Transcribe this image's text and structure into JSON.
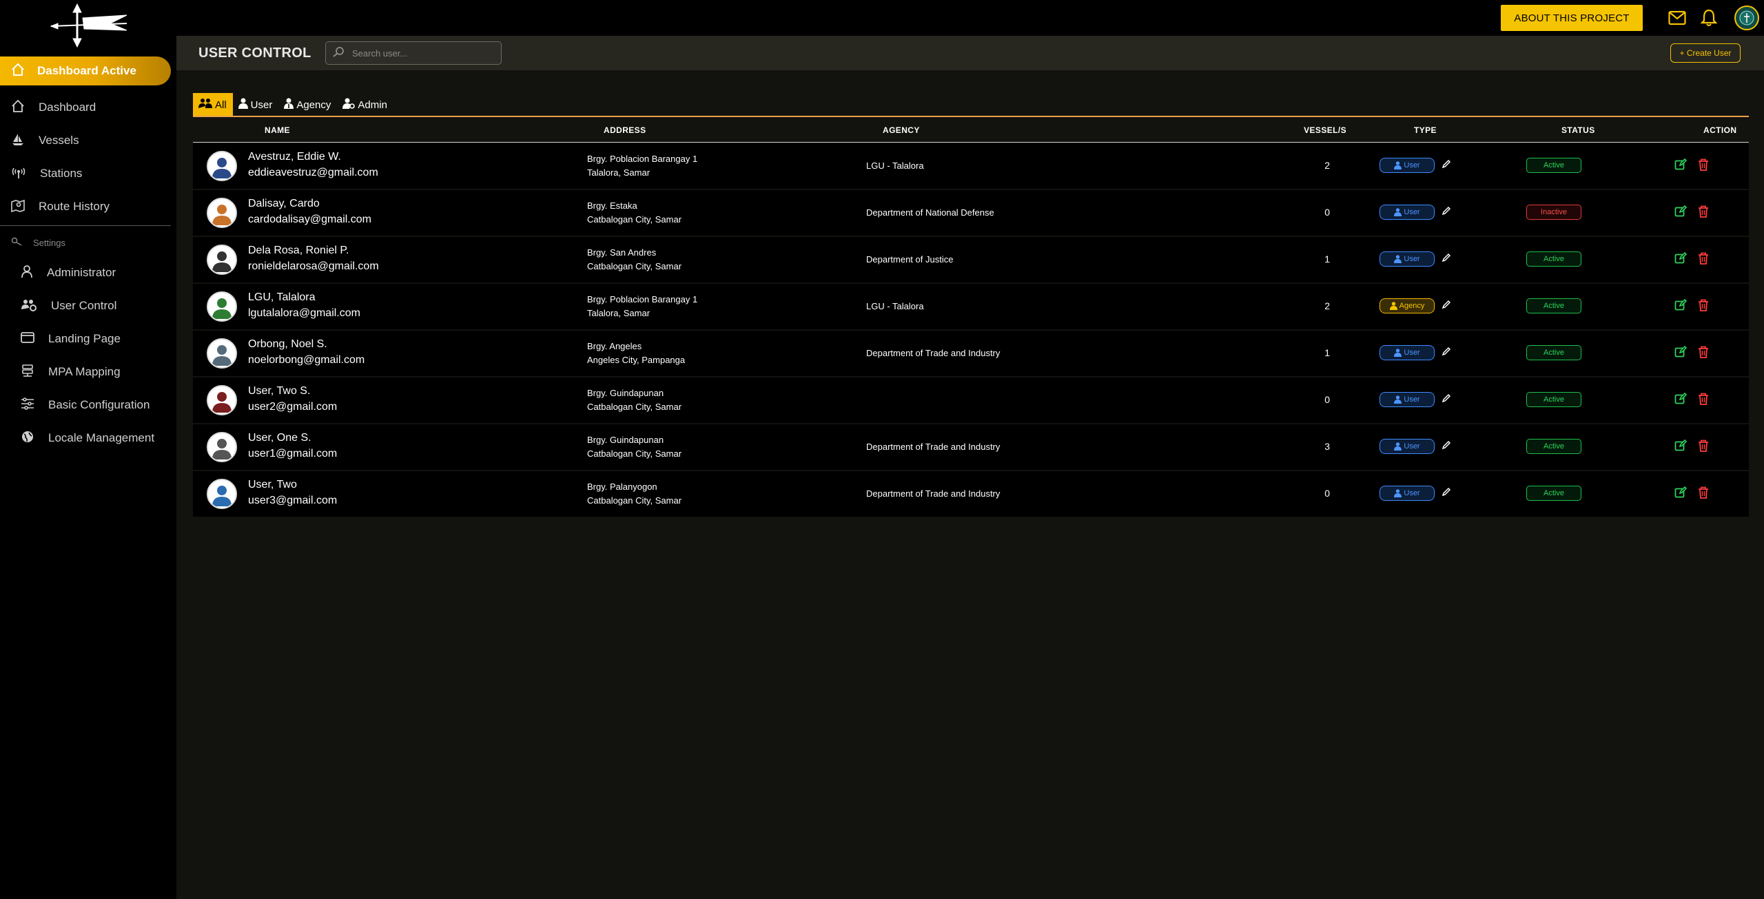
{
  "app": {
    "about_label": "ABOUT THIS PROJECT"
  },
  "sidebar": {
    "active_label": "Dashboard Active",
    "items": [
      {
        "label": "Dashboard",
        "icon": "house-icon"
      },
      {
        "label": "Vessels",
        "icon": "sailboat-icon"
      },
      {
        "label": "Stations",
        "icon": "antenna-icon"
      },
      {
        "label": "Route History",
        "icon": "map-pin-icon"
      }
    ],
    "settings_label": "Settings",
    "settings_items": [
      {
        "label": "Administrator",
        "icon": "person-icon"
      },
      {
        "label": "User Control",
        "icon": "users-gear-icon"
      },
      {
        "label": "Landing Page",
        "icon": "window-icon"
      },
      {
        "label": "MPA Mapping",
        "icon": "server-icon"
      },
      {
        "label": "Basic Configuration",
        "icon": "sliders-icon"
      },
      {
        "label": "Locale Management",
        "icon": "globe-icon"
      }
    ]
  },
  "page": {
    "title": "USER CONTROL",
    "search_placeholder": "Search user...",
    "create_label": "+ Create User"
  },
  "tabs": [
    {
      "label": "All",
      "active": true
    },
    {
      "label": "User",
      "active": false
    },
    {
      "label": "Agency",
      "active": false
    },
    {
      "label": "Admin",
      "active": false
    }
  ],
  "table": {
    "headers": {
      "name": "NAME",
      "address": "ADDRESS",
      "agency": "AGENCY",
      "vessels": "VESSEL/S",
      "type": "TYPE",
      "status": "STATUS",
      "action": "ACTION"
    },
    "rows": [
      {
        "name": "Avestruz, Eddie W.",
        "email": "eddieavestruz@gmail.com",
        "addr1": "Brgy. Poblacion Barangay 1",
        "addr2": "Talalora, Samar",
        "agency": "LGU - Talalora",
        "vessels": "2",
        "type": "User",
        "status": "Active"
      },
      {
        "name": "Dalisay, Cardo",
        "email": "cardodalisay@gmail.com",
        "addr1": "Brgy. Estaka",
        "addr2": "Catbalogan City, Samar",
        "agency": "Department of National Defense",
        "vessels": "0",
        "type": "User",
        "status": "Inactive"
      },
      {
        "name": "Dela Rosa, Roniel P.",
        "email": "ronieldelarosa@gmail.com",
        "addr1": "Brgy. San Andres",
        "addr2": "Catbalogan City, Samar",
        "agency": "Department of Justice",
        "vessels": "1",
        "type": "User",
        "status": "Active"
      },
      {
        "name": "LGU, Talalora",
        "email": "lgutalalora@gmail.com",
        "addr1": "Brgy. Poblacion Barangay 1",
        "addr2": "Talalora, Samar",
        "agency": "LGU - Talalora",
        "vessels": "2",
        "type": "Agency",
        "status": "Active"
      },
      {
        "name": "Orbong, Noel S.",
        "email": "noelorbong@gmail.com",
        "addr1": "Brgy. Angeles",
        "addr2": "Angeles City, Pampanga",
        "agency": "Department of Trade and Industry",
        "vessels": "1",
        "type": "User",
        "status": "Active"
      },
      {
        "name": "User, Two S.",
        "email": "user2@gmail.com",
        "addr1": "Brgy. Guindapunan",
        "addr2": "Catbalogan City, Samar",
        "agency": "",
        "vessels": "0",
        "type": "User",
        "status": "Active"
      },
      {
        "name": "User, One S.",
        "email": "user1@gmail.com",
        "addr1": "Brgy. Guindapunan",
        "addr2": "Catbalogan City, Samar",
        "agency": "Department of Trade and Industry",
        "vessels": "3",
        "type": "User",
        "status": "Active"
      },
      {
        "name": "User, Two",
        "email": "user3@gmail.com",
        "addr1": "Brgy. Palanyogon",
        "addr2": "Catbalogan City, Samar",
        "agency": "Department of Trade and Industry",
        "vessels": "0",
        "type": "User",
        "status": "Active"
      }
    ]
  },
  "colors": {
    "accent": "#f5c400",
    "active_green": "#2ed35c",
    "inactive_red": "#ff4d4d",
    "user_blue": "#4d95ff"
  }
}
